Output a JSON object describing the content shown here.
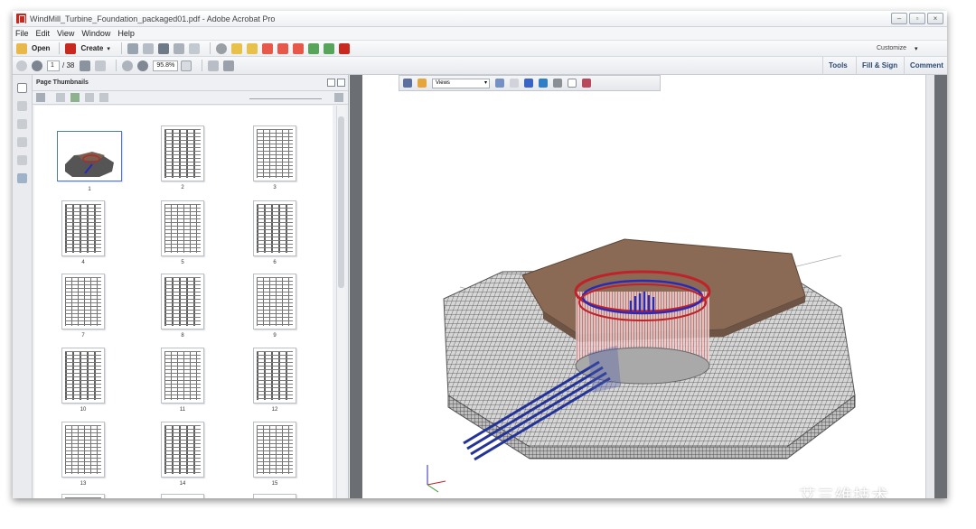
{
  "window": {
    "title": "WindMill_Turbine_Foundation_packaged01.pdf - Adobe Acrobat Pro",
    "controls": [
      "–",
      "▫",
      "×"
    ]
  },
  "menu": [
    "File",
    "Edit",
    "View",
    "Window",
    "Help"
  ],
  "toolbar": {
    "open_label": "Open",
    "create_label": "Create",
    "customize_label": "Customize"
  },
  "nav": {
    "page_current": "1",
    "page_total": "/ 38",
    "zoom": "95.8%"
  },
  "right_tabs": [
    "Tools",
    "Fill & Sign",
    "Comment"
  ],
  "panel": {
    "title": "Page Thumbnails",
    "thumbnails": [
      "1",
      "2",
      "3",
      "4",
      "5",
      "6",
      "7",
      "8",
      "9",
      "10",
      "11",
      "12",
      "13",
      "14",
      "15"
    ]
  },
  "doc3d": {
    "views_label": "Views"
  },
  "watermark": "艾三维技术",
  "colors": {
    "rebar_red": "#c0222a",
    "rebar_blue": "#2a2ab8",
    "pedestal": "#8a6a55",
    "mesh": "#3c3c3c"
  }
}
